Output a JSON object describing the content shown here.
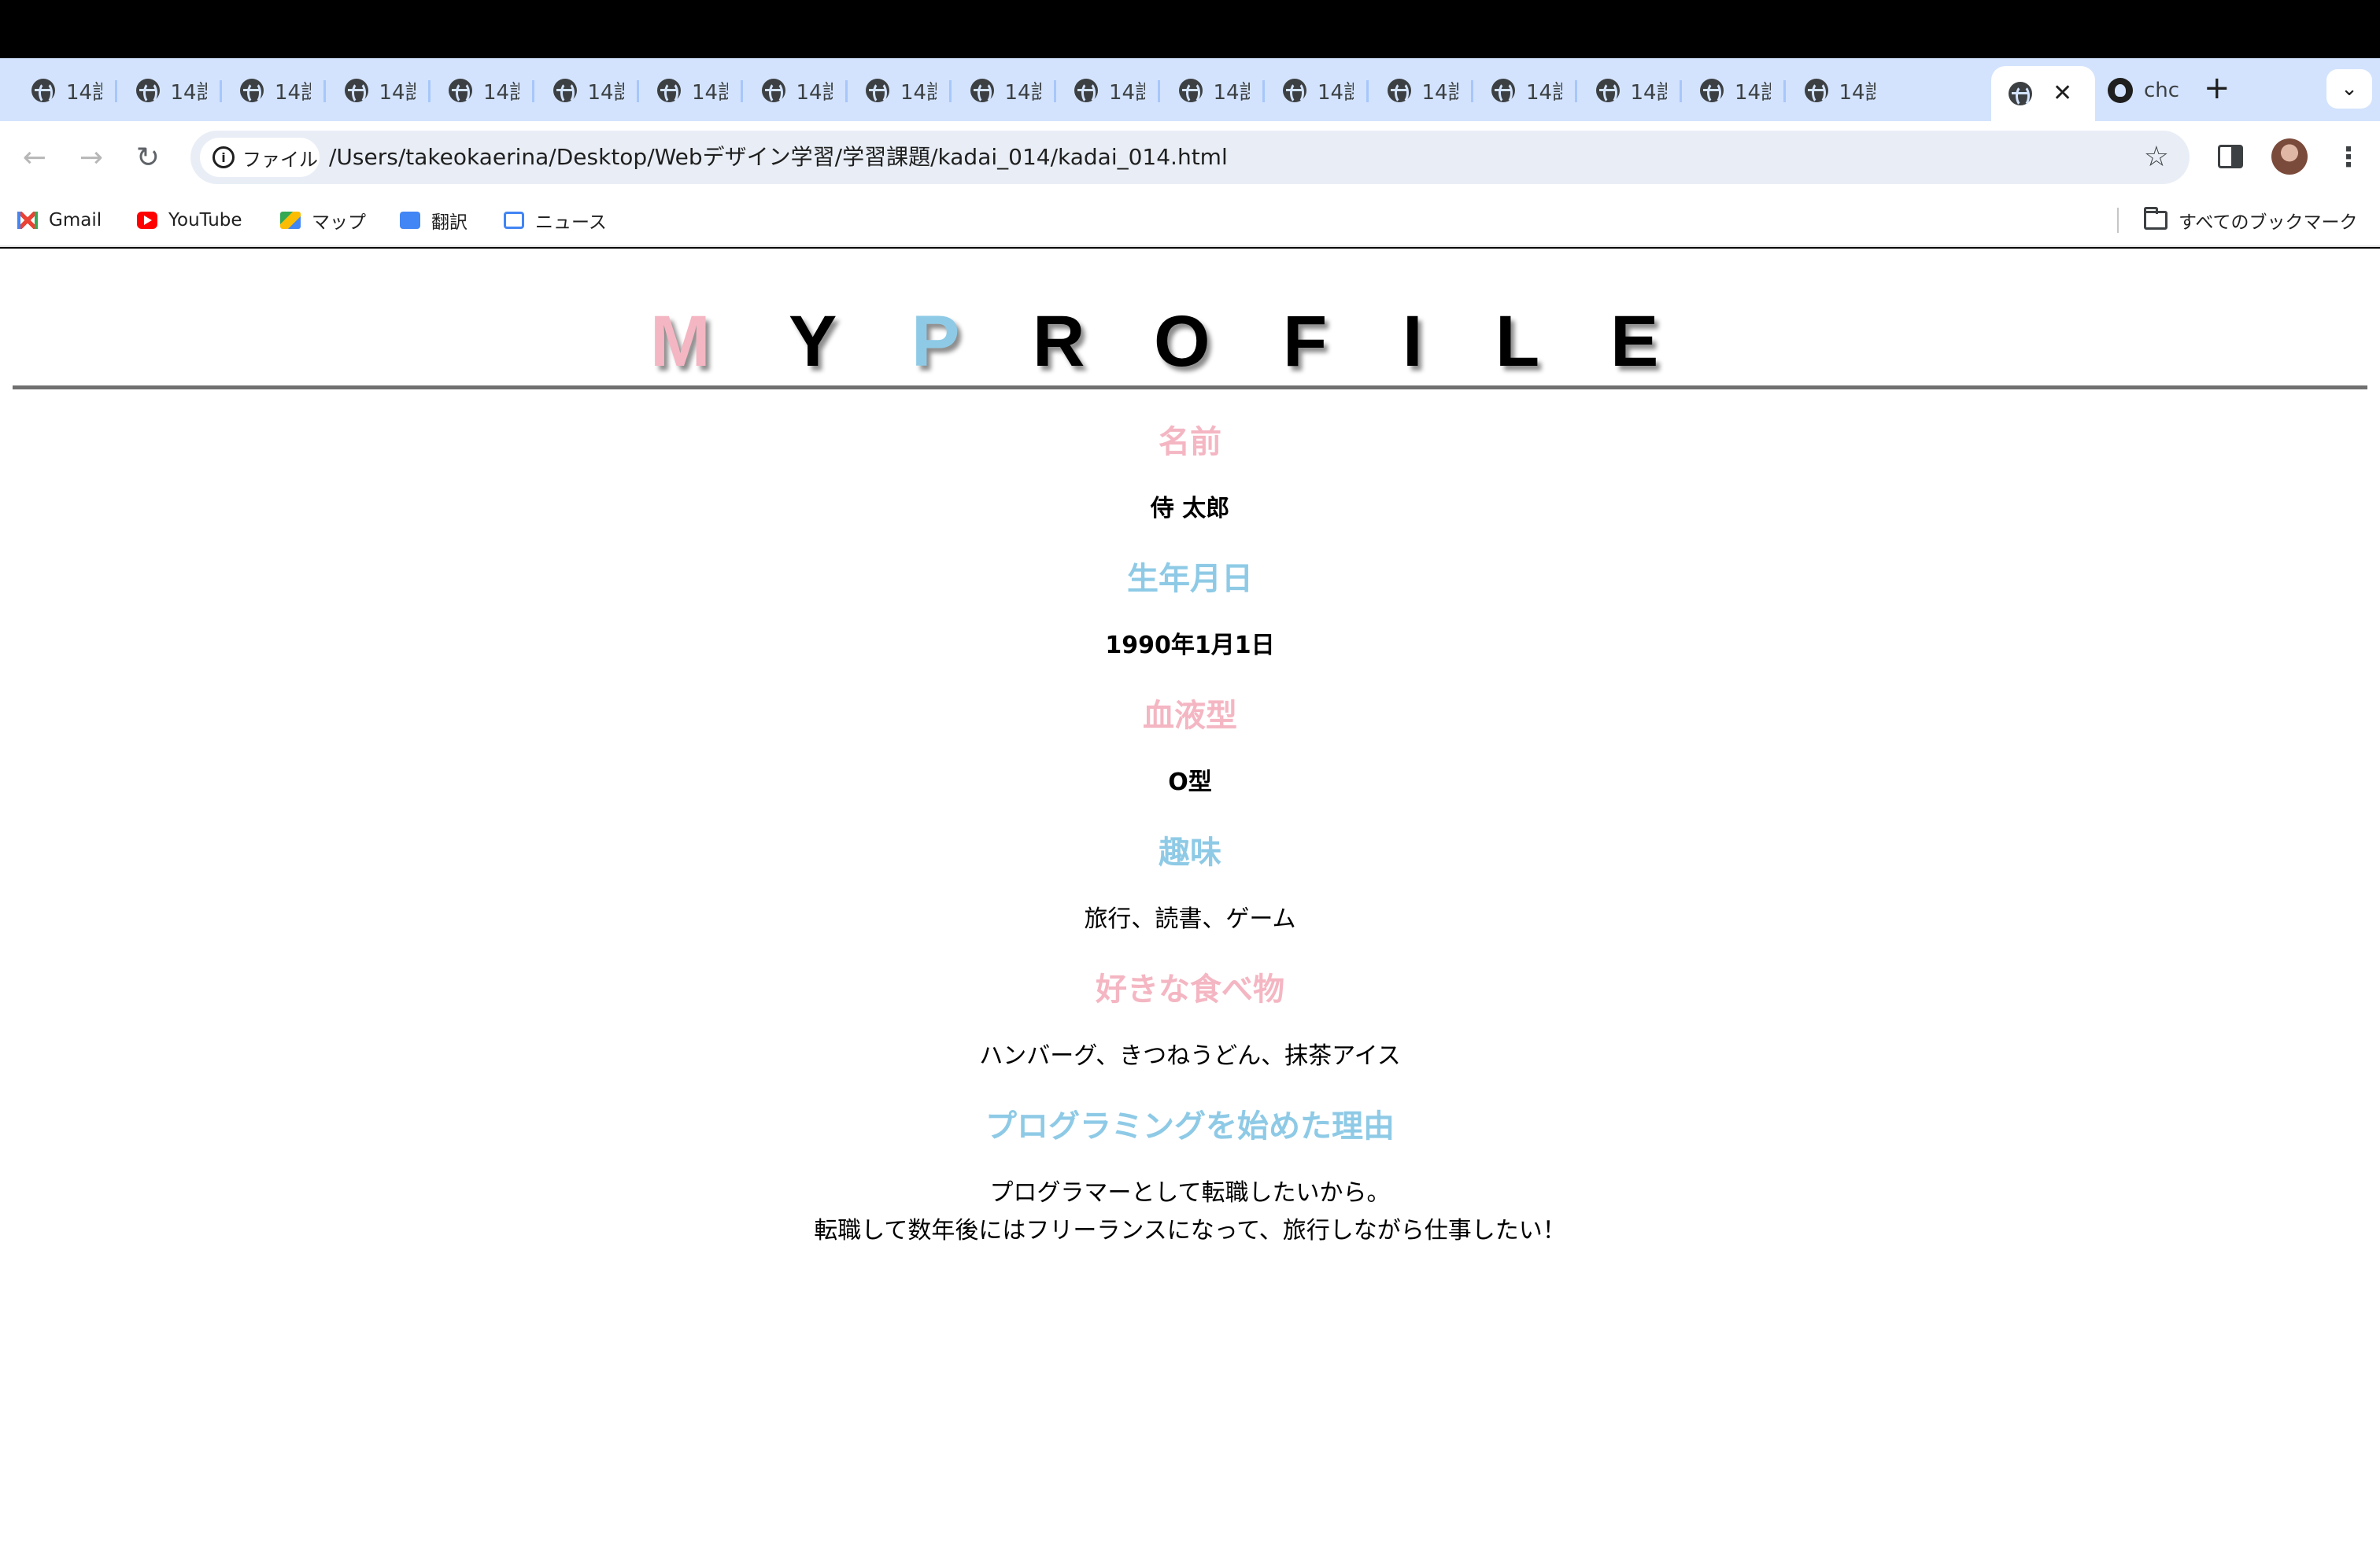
{
  "browser": {
    "tabs": [
      {
        "title": "14課"
      },
      {
        "title": "14課"
      },
      {
        "title": "14課"
      },
      {
        "title": "14課"
      },
      {
        "title": "14課"
      },
      {
        "title": "14課"
      },
      {
        "title": "14課"
      },
      {
        "title": "14課"
      },
      {
        "title": "14課"
      },
      {
        "title": "14課"
      },
      {
        "title": "14課"
      },
      {
        "title": "14課"
      },
      {
        "title": "14課"
      },
      {
        "title": "14課"
      },
      {
        "title": "14課"
      },
      {
        "title": "14課"
      },
      {
        "title": "14課"
      },
      {
        "title": "14課"
      }
    ],
    "active_tab_close": "✕",
    "github_tab_title": "chc",
    "new_tab_label": "+",
    "tab_search_label": "⌄",
    "back": "←",
    "forward": "→",
    "reload": "↻",
    "security_chip": "ファイル",
    "security_icon": "i",
    "url": "/Users/takeokaerina/Desktop/Webデザイン学習/学習課題/kadai_014/kadai_014.html",
    "bookmark_star": "☆",
    "menu": "⋮",
    "bookmarks": [
      {
        "label": "Gmail",
        "icon": "gmail-icon"
      },
      {
        "label": "YouTube",
        "icon": "youtube-icon"
      },
      {
        "label": "マップ",
        "icon": "maps-icon"
      },
      {
        "label": "翻訳",
        "icon": "translate-icon"
      },
      {
        "label": "ニュース",
        "icon": "news-icon"
      }
    ],
    "all_bookmarks": "すべてのブックマーク"
  },
  "page": {
    "hero_letters": [
      "M",
      "Y",
      "P",
      "R",
      "O",
      "F",
      "I",
      "L",
      "E"
    ],
    "colors": {
      "pink": "#f4b6c2",
      "blue": "#8ecae6",
      "black": "#000000",
      "rule": "#707070"
    },
    "sections": [
      {
        "heading": "名前",
        "value": "侍 太郎"
      },
      {
        "heading": "生年月日",
        "value": "1990年1月1日"
      },
      {
        "heading": "血液型",
        "value": "O型"
      },
      {
        "heading": "趣味",
        "value": "旅行、読書、ゲーム"
      },
      {
        "heading": "好きな食べ物",
        "value": "ハンバーグ、きつねうどん、抹茶アイス"
      },
      {
        "heading": "プログラミングを始めた理由",
        "value": "プログラマーとして転職したいから。",
        "value2": "転職して数年後にはフリーランスになって、旅行しながら仕事したい！"
      }
    ]
  }
}
